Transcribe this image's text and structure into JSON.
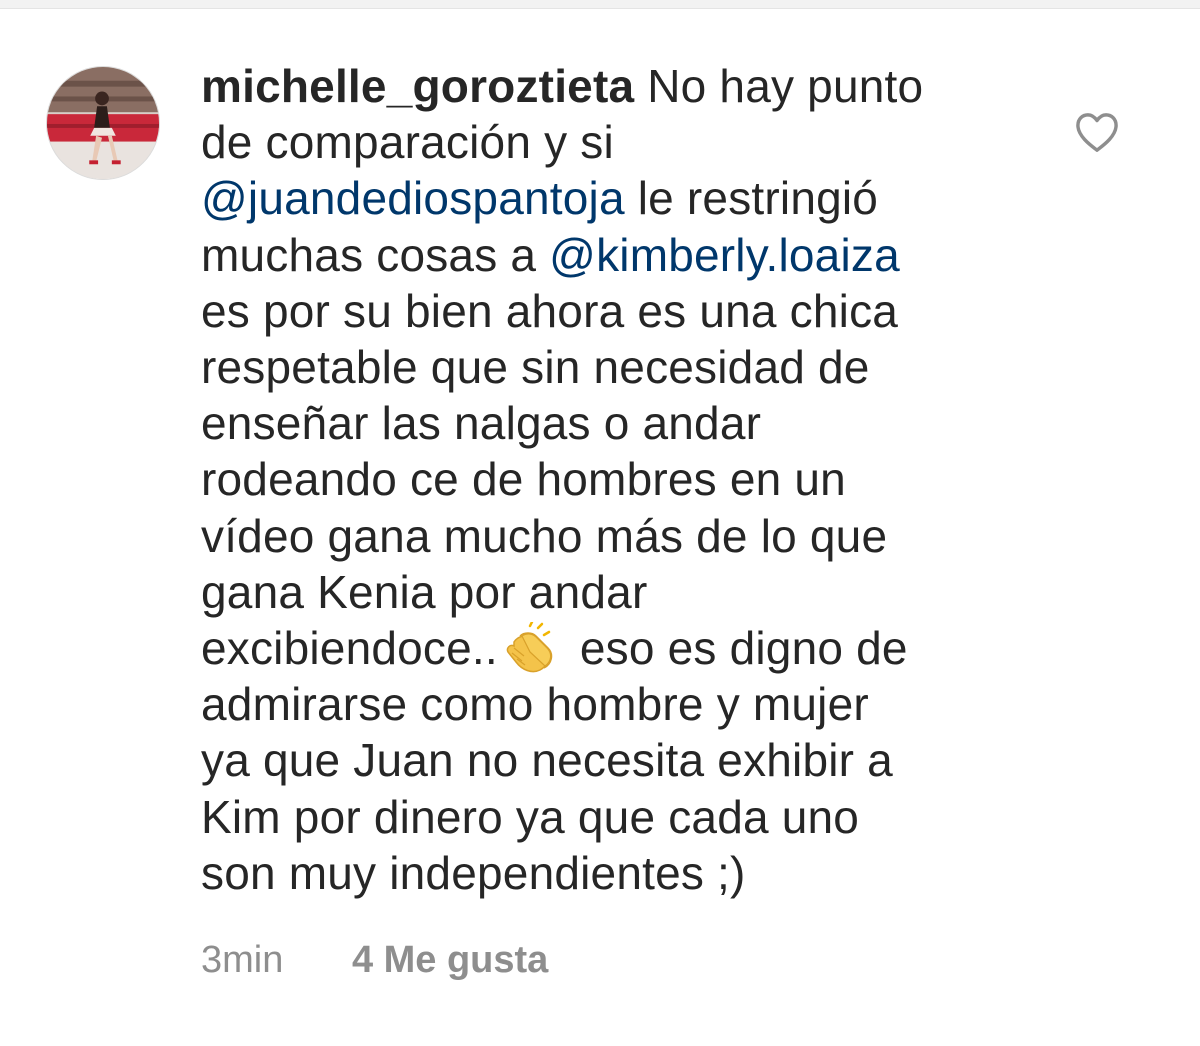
{
  "comment": {
    "username": "michelle_goroztieta",
    "text_segments": {
      "l1": "No hay punto",
      "l2": "de comparación y si",
      "mention1": "@juandediospantoja",
      "l3_rest": " le restringió",
      "l4_start": "muchas cosas a ",
      "mention2": "@kimberly.loaiza",
      "l5": "es por su bien ahora es una chica",
      "l6": "respetable que sin necesidad de",
      "l7": "enseñar las nalgas o andar",
      "l8": "rodeando ce de hombres en un",
      "l9": "vídeo gana mucho más de lo que",
      "l10": "gana Kenia por andar",
      "l11_start": "excibiendoce..",
      "l11_end": "eso es digno de",
      "l12": "admirarse como hombre y mujer",
      "l13": "ya que Juan no necesita exhibir a",
      "l14": "Kim por dinero ya que cada uno",
      "l15": "son muy independientes ;)"
    },
    "emoji": "clapping-hands-icon",
    "time": "3min",
    "likes": "4 Me gusta"
  },
  "colors": {
    "text": "#262626",
    "mention": "#00376b",
    "meta": "#8e8e8e",
    "heart_stroke": "#8e8e8e"
  }
}
